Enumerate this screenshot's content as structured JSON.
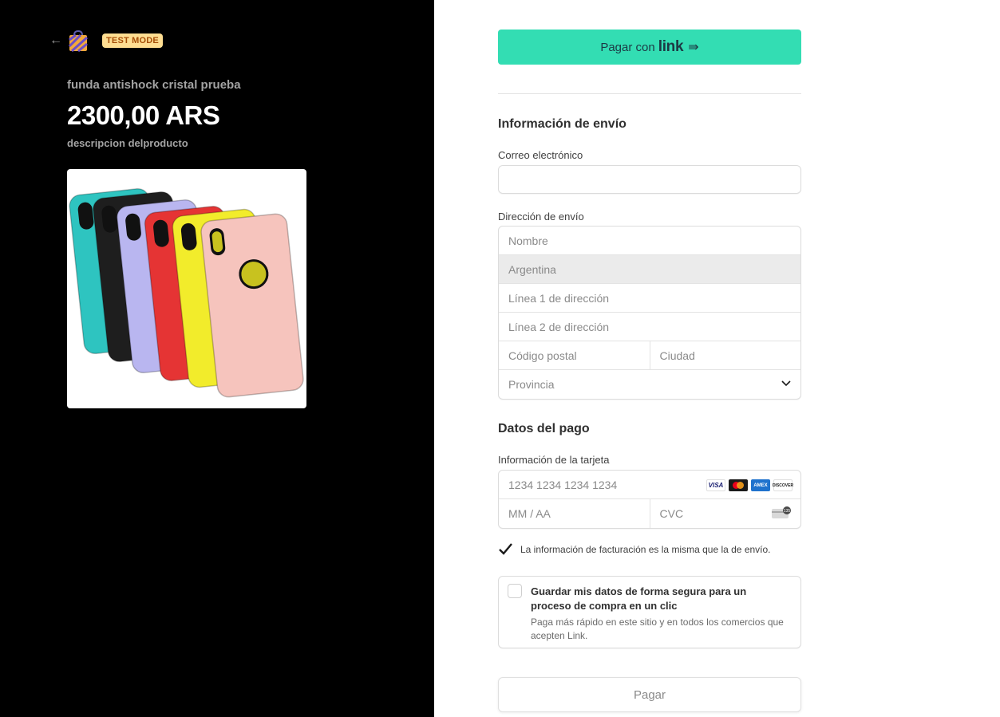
{
  "header": {
    "test_badge": "TEST MODE"
  },
  "product": {
    "name": "funda antishock cristal prueba",
    "price": "2300,00 ARS",
    "description": "descripcion delproducto",
    "image_colors": [
      "#2ec4c0",
      "#1e1e1e",
      "#b9b6f0",
      "#e53434",
      "#f2ec2b",
      "#f6c4bd"
    ]
  },
  "link_button": {
    "label": "Pagar con",
    "logo": "link",
    "arrow": "⇛"
  },
  "shipping": {
    "title": "Información de envío",
    "email_label": "Correo electrónico",
    "email_value": "",
    "address_label": "Dirección de envío",
    "name_placeholder": "Nombre",
    "country": "Argentina",
    "line1_placeholder": "Línea 1 de dirección",
    "line2_placeholder": "Línea 2 de dirección",
    "postal_placeholder": "Código postal",
    "city_placeholder": "Ciudad",
    "province_placeholder": "Provincia"
  },
  "payment": {
    "title": "Datos del pago",
    "card_label": "Información de la tarjeta",
    "card_placeholder": "1234 1234 1234 1234",
    "expiry_placeholder": "MM / AA",
    "cvc_placeholder": "CVC",
    "brands": [
      "VISA",
      "mastercard",
      "AMEX",
      "DISCOVER"
    ],
    "cvc_hint": "135"
  },
  "billing_same": {
    "checked": true,
    "text": "La información de facturación es la misma que la de envío."
  },
  "save_info": {
    "checked": false,
    "title": "Guardar mis datos de forma segura para un proceso de compra en un clic",
    "subtitle": "Paga más rápido en este sitio y en todos los comercios que acepten Link."
  },
  "pay_button": {
    "label": "Pagar"
  },
  "colors": {
    "left_bg": "#000000",
    "link_green": "#33ddb3",
    "badge_bg": "#ffde92",
    "badge_text": "#a64f08"
  }
}
